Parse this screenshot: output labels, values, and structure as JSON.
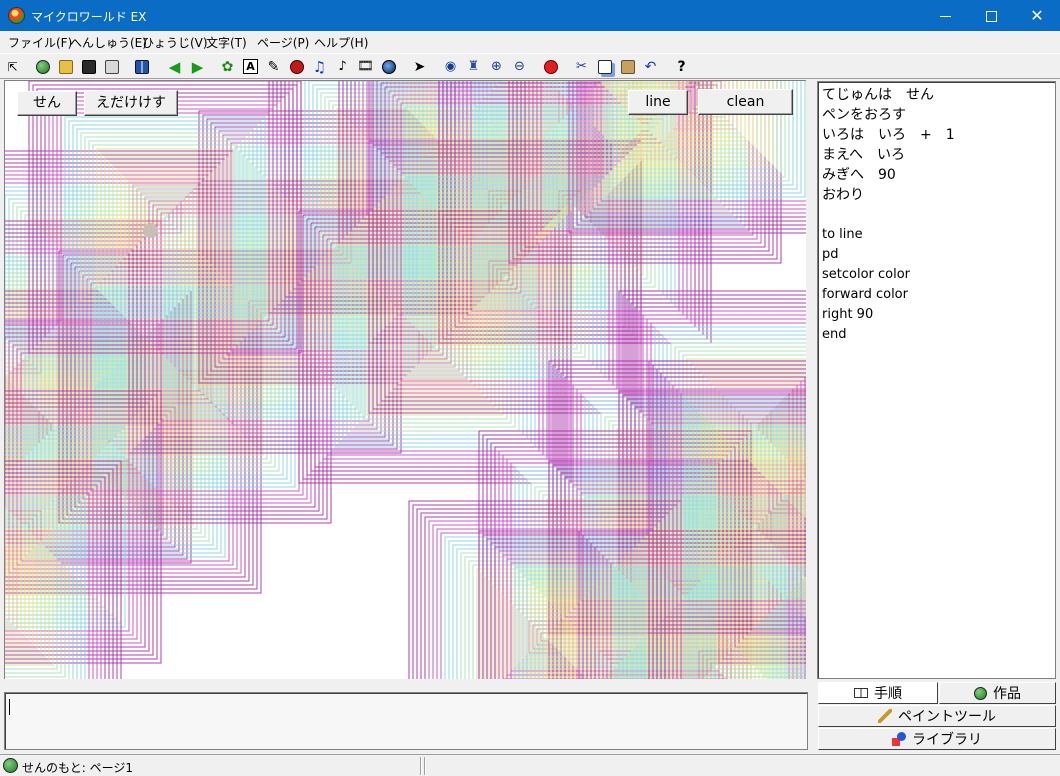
{
  "window": {
    "title": "マイクロワールド EX",
    "minimize_icon": "minimize-icon",
    "maximize_icon": "maximize-icon",
    "close_icon": "close-icon"
  },
  "menu": [
    "ファイル(F)",
    "へんしゅう(E)",
    "ひょうじ(V)",
    "文字(T)",
    "ページ(P)",
    "ヘルプ(H)"
  ],
  "toolbar": {
    "icons": [
      "pointer-mode-icon",
      "globe-icon",
      "open-folder-icon",
      "save-icon",
      "print-icon",
      "page-layout-icon",
      "back-arrow-icon",
      "forward-arrow-icon",
      "new-turtle-icon",
      "text-box-icon",
      "brush-icon",
      "eye-button-icon",
      "music-note-icon",
      "melody-icon",
      "video-icon",
      "record-icon",
      "select-arrow-icon",
      "eye-icon",
      "stamp-icon",
      "zoom-in-icon",
      "zoom-out-icon",
      "stop-hand-icon",
      "cut-icon",
      "copy-icon",
      "paste-icon",
      "undo-icon",
      "help-icon"
    ],
    "text_box_glyph": "A",
    "help_glyph": "?"
  },
  "canvas": {
    "buttons": {
      "sen": "せん",
      "edaketesu": "えだけけす",
      "line": "line",
      "clean": "clean"
    },
    "colors": [
      "#a020a0",
      "#c040c0",
      "#7fd0e0",
      "#9fe0b0",
      "#c8e880",
      "#f0e070",
      "#f4b870",
      "#e07070"
    ]
  },
  "procedures": {
    "lines": [
      "てじゅんは　せん",
      "ペンをおろす",
      "いろは　いろ　+　1",
      "まえへ　いろ",
      "みぎへ　90",
      "おわり",
      "",
      "to line",
      "pd",
      "setcolor  color",
      "forward  color",
      "right  90",
      "end"
    ]
  },
  "tabs": {
    "procedures": "手順",
    "project": "作品",
    "paint_tools": "ペイントツール",
    "library": "ライブラリ"
  },
  "status": {
    "text": "せんのもと: ページ1"
  }
}
